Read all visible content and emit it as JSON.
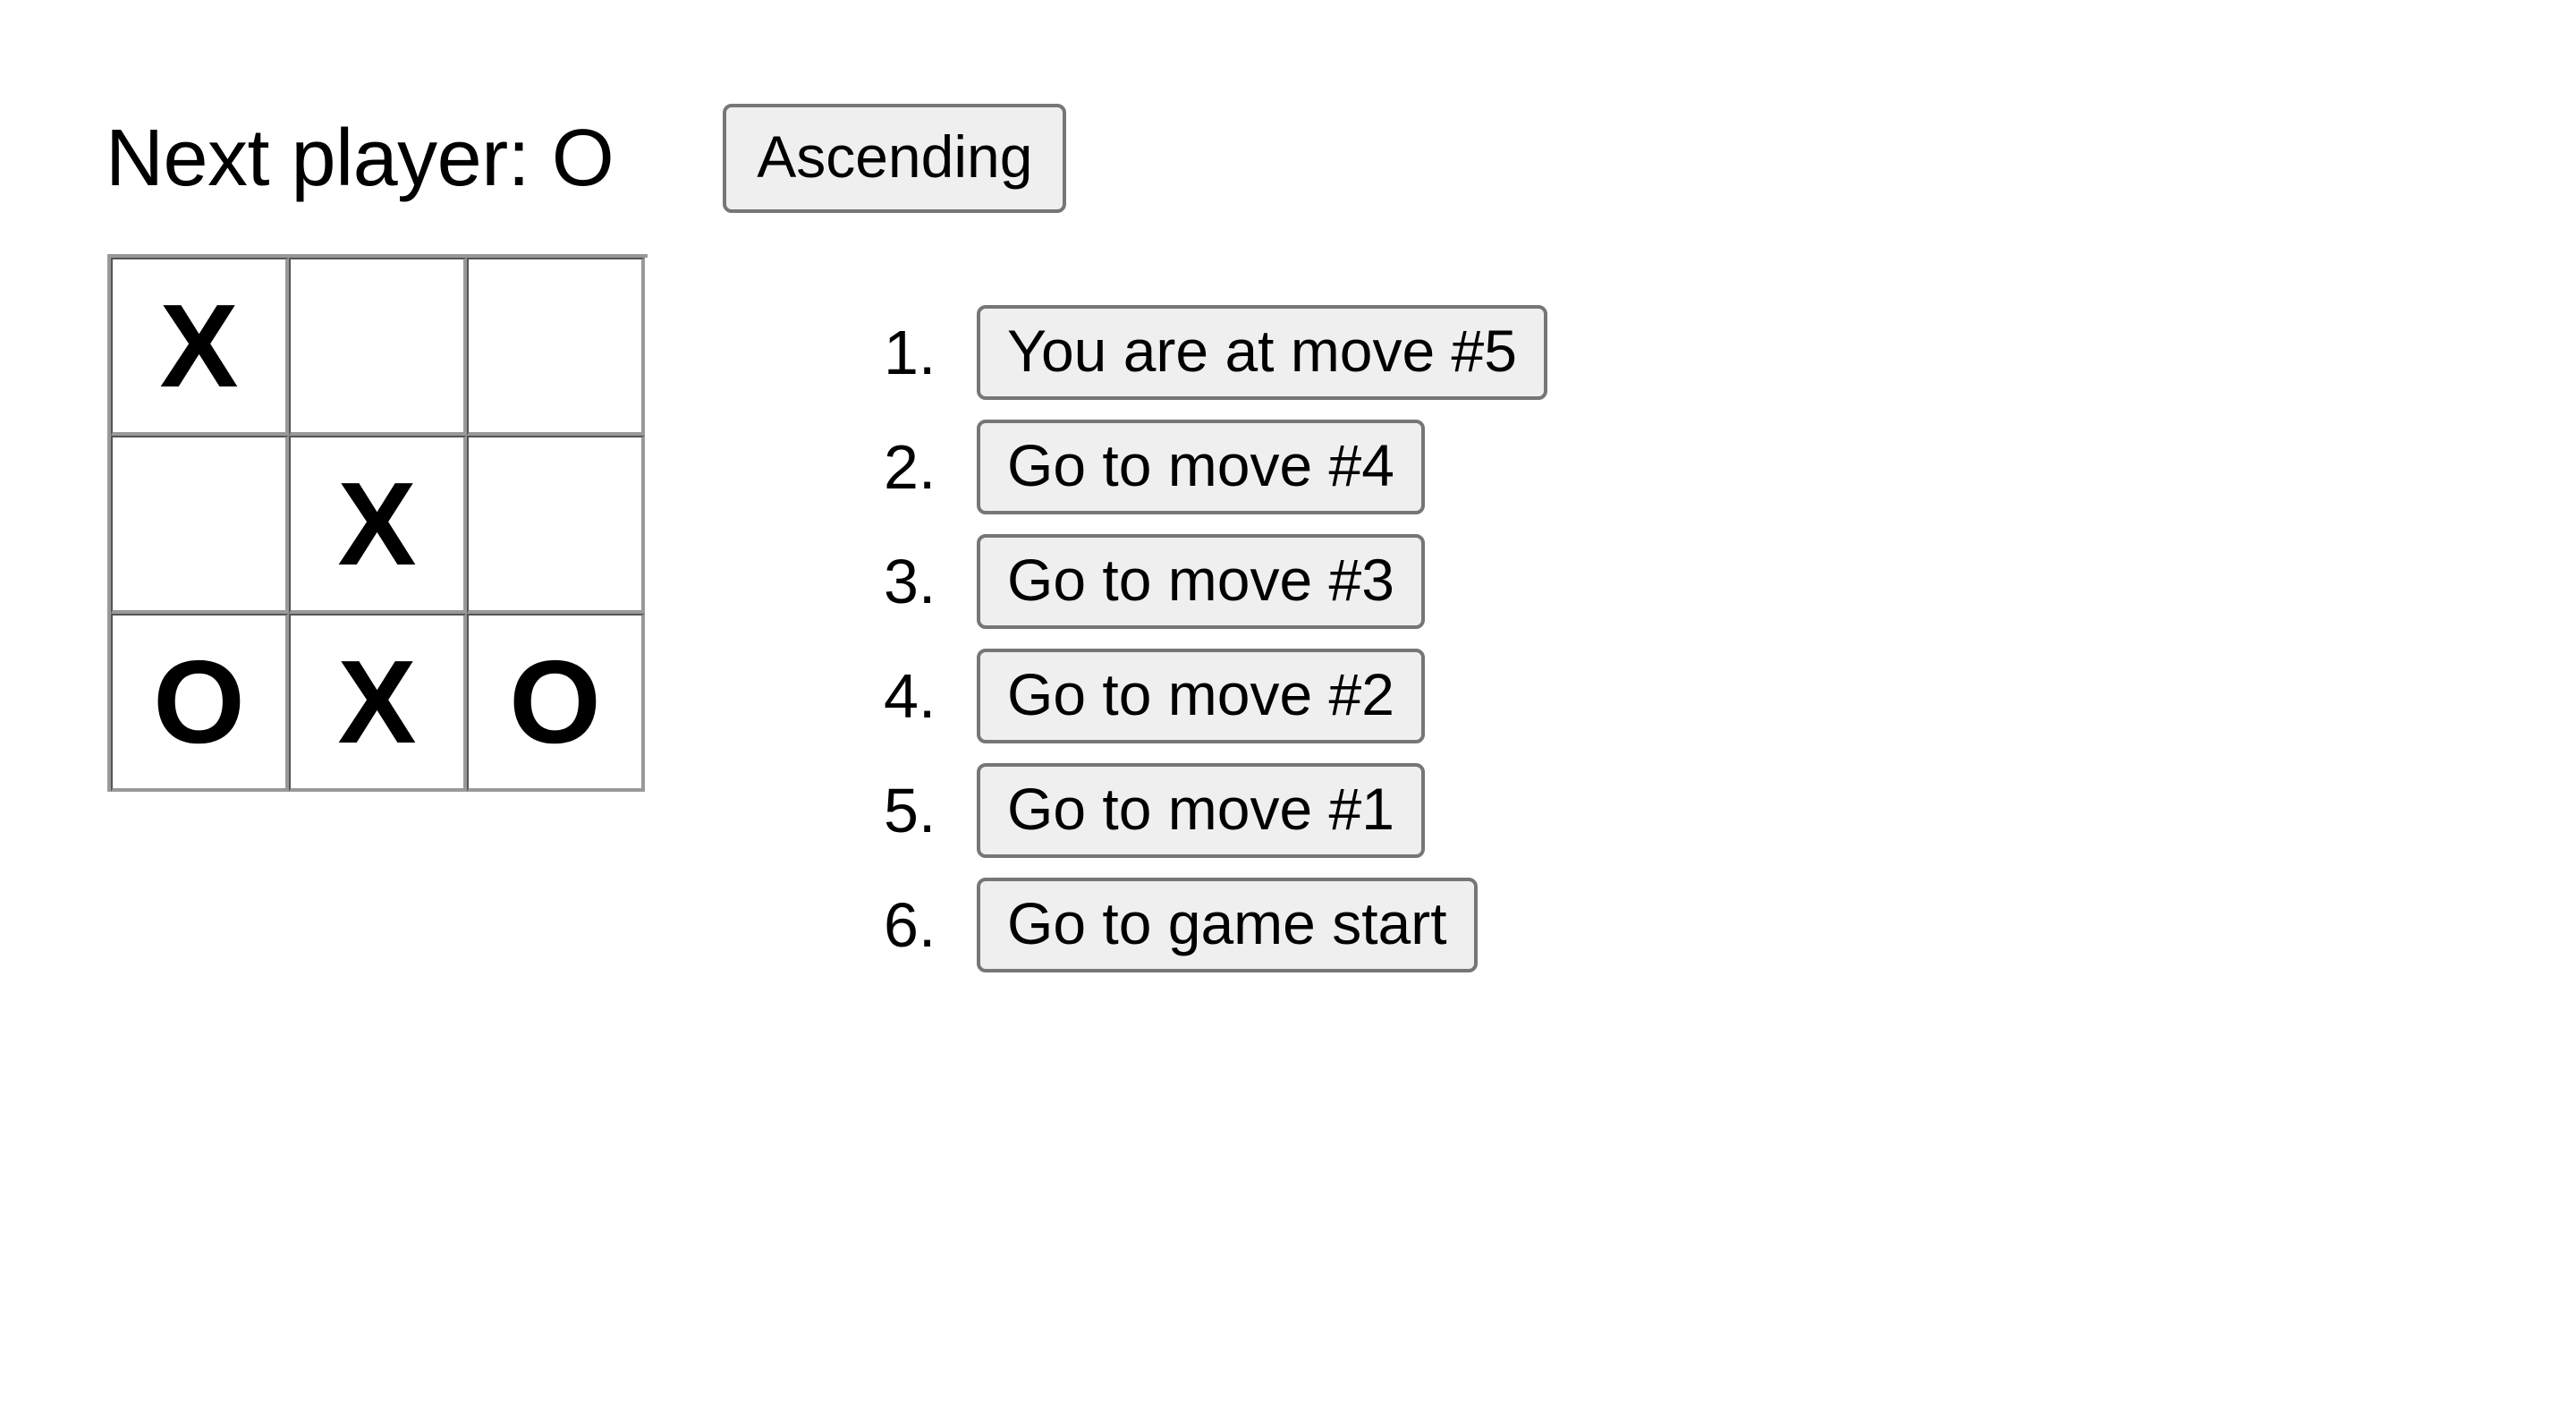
{
  "game": {
    "status": "Next player: O",
    "next_player": "O",
    "sort_toggle_label": "Ascending",
    "board": [
      [
        "X",
        "",
        ""
      ],
      [
        "",
        "X",
        ""
      ],
      [
        "O",
        "X",
        "O"
      ]
    ],
    "board_flat": [
      "X",
      "",
      "",
      "",
      "X",
      "",
      "O",
      "X",
      "O"
    ]
  },
  "moves": {
    "items": [
      {
        "number": "1.",
        "label": "You are at move #5"
      },
      {
        "number": "2.",
        "label": "Go to move #4"
      },
      {
        "number": "3.",
        "label": "Go to move #3"
      },
      {
        "number": "4.",
        "label": "Go to move #2"
      },
      {
        "number": "5.",
        "label": "Go to move #1"
      },
      {
        "number": "6.",
        "label": "Go to game start"
      }
    ]
  },
  "colors": {
    "background": "#ffffff",
    "text": "#000000",
    "button_fill": "#efefef",
    "button_border": "#767676",
    "grid_line": "#999999"
  }
}
